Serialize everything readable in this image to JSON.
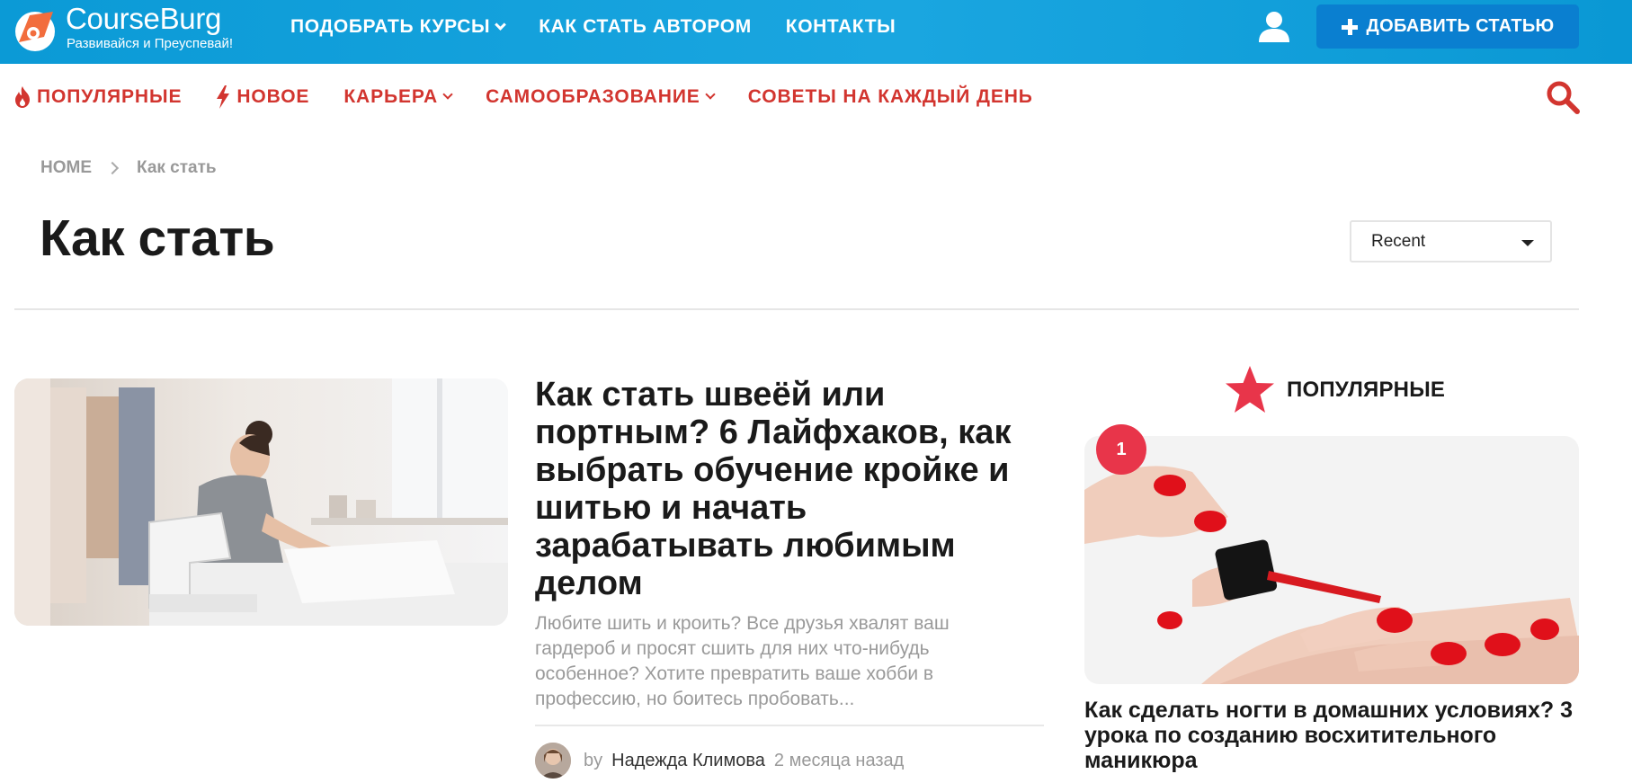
{
  "header": {
    "logo_name": "CourseBurg",
    "logo_tagline": "Развивайся и Преуспевай!",
    "nav": [
      {
        "label": "ПОДОБРАТЬ КУРСЫ",
        "has_dropdown": true
      },
      {
        "label": "КАК СТАТЬ АВТОРОМ",
        "has_dropdown": false
      },
      {
        "label": "КОНТАКТЫ",
        "has_dropdown": false
      }
    ],
    "user_icon": "user-icon",
    "add_button_label": "ДОБАВИТЬ СТАТЬЮ",
    "colors": {
      "bar": "#0b9ad6",
      "button": "#0a7fd0"
    }
  },
  "category_nav": {
    "items": [
      {
        "label": "ПОПУЛЯРНЫЕ",
        "icon": "flame-icon"
      },
      {
        "label": "НОВОЕ",
        "icon": "lightning-icon"
      },
      {
        "label": "КАРЬЕРА",
        "has_dropdown": true
      },
      {
        "label": "САМООБРАЗОВАНИЕ",
        "has_dropdown": true
      },
      {
        "label": "СОВЕТЫ НА КАЖДЫЙ ДЕНЬ"
      }
    ],
    "color": "#d2352f",
    "search_icon": "search-icon"
  },
  "breadcrumb": {
    "home": "HOME",
    "current": "Как стать"
  },
  "page_title": "Как стать",
  "sort": {
    "selected": "Recent"
  },
  "article": {
    "title": "Как стать швеёй или портным? 6 Лайфхаков, как выбрать обучение кройке и шитью и начать зарабатывать любимым делом",
    "excerpt": "Любите шить и кроить? Все друзья хвалят ваш гардероб и просят сшить для них что-нибудь особенное? Хотите превратить ваше хобби в профессию, но боитесь пробовать...",
    "by": "by",
    "author": "Надежда Климова",
    "time": "2 месяца назад"
  },
  "sidebar": {
    "heading": "ПОПУЛЯРНЫЕ",
    "items": [
      {
        "rank": "1",
        "title": "Как сделать ногти в домашних условиях? 3 урока по созданию восхитительного маникюра"
      }
    ]
  }
}
